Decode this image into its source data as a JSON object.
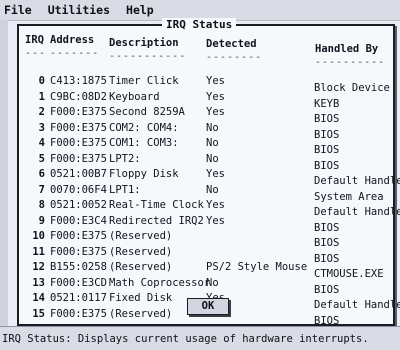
{
  "menu": [
    "File",
    "Utilities",
    "Help"
  ],
  "dialog": {
    "title": "IRQ Status",
    "headers": {
      "irq": "IRQ",
      "address": "Address",
      "description": "Description",
      "detected": "Detected",
      "handled_by": "Handled By"
    },
    "rows": [
      {
        "irq": "0",
        "address": "C413:1875",
        "description": "Timer Click",
        "detected": "Yes",
        "handled_by": "Block Device"
      },
      {
        "irq": "1",
        "address": "C9BC:08D2",
        "description": "Keyboard",
        "detected": "Yes",
        "handled_by": "KEYB"
      },
      {
        "irq": "2",
        "address": "F000:E375",
        "description": "Second 8259A",
        "detected": "Yes",
        "handled_by": "BIOS"
      },
      {
        "irq": "3",
        "address": "F000:E375",
        "description": "COM2: COM4:",
        "detected": "No",
        "handled_by": "BIOS"
      },
      {
        "irq": "4",
        "address": "F000:E375",
        "description": "COM1: COM3:",
        "detected": "No",
        "handled_by": "BIOS"
      },
      {
        "irq": "5",
        "address": "F000:E375",
        "description": "LPT2:",
        "detected": "No",
        "handled_by": "BIOS"
      },
      {
        "irq": "6",
        "address": "0521:00B7",
        "description": "Floppy Disk",
        "detected": "Yes",
        "handled_by": "Default Handlers"
      },
      {
        "irq": "7",
        "address": "0070:06F4",
        "description": "LPT1:",
        "detected": "No",
        "handled_by": "System Area"
      },
      {
        "irq": "8",
        "address": "0521:0052",
        "description": "Real-Time Clock",
        "detected": "Yes",
        "handled_by": "Default Handlers"
      },
      {
        "irq": "9",
        "address": "F000:E3C4",
        "description": "Redirected IRQ2",
        "detected": "Yes",
        "handled_by": "BIOS"
      },
      {
        "irq": "10",
        "address": "F000:E375",
        "description": "(Reserved)",
        "detected": "",
        "handled_by": "BIOS"
      },
      {
        "irq": "11",
        "address": "F000:E375",
        "description": "(Reserved)",
        "detected": "",
        "handled_by": "BIOS"
      },
      {
        "irq": "12",
        "address": "B155:0258",
        "description": "(Reserved)",
        "detected": "PS/2 Style Mouse",
        "handled_by": "CTMOUSE.EXE"
      },
      {
        "irq": "13",
        "address": "F000:E3CD",
        "description": "Math Coprocessor",
        "detected": "No",
        "handled_by": "BIOS"
      },
      {
        "irq": "14",
        "address": "0521:0117",
        "description": "Fixed Disk",
        "detected": "Yes",
        "handled_by": "Default Handlers"
      },
      {
        "irq": "15",
        "address": "F000:E375",
        "description": "(Reserved)",
        "detected": "",
        "handled_by": "BIOS"
      }
    ],
    "ok_label": "OK"
  },
  "status_bar": {
    "text": "IRQ Status: Displays current usage of hardware interrupts."
  }
}
